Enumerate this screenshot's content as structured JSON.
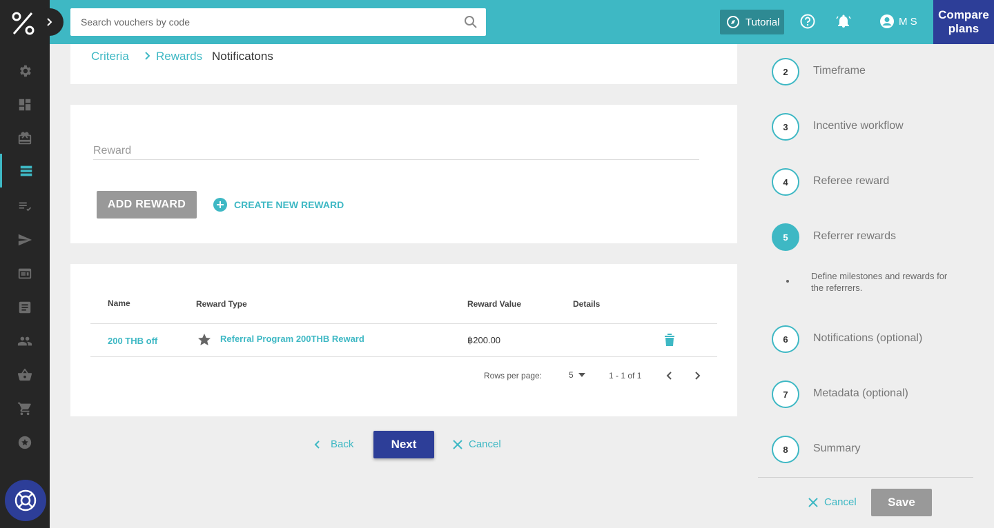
{
  "app": {
    "logo_text": "%",
    "accent_color": "#3eb8c4",
    "brand_color": "#2d3e98"
  },
  "sidebar": {
    "items": [
      {
        "icon": "gear-icon"
      },
      {
        "icon": "dashboard-icon"
      },
      {
        "icon": "gift-card-icon"
      },
      {
        "icon": "campaigns-list-icon",
        "active": true
      },
      {
        "icon": "validation-rules-icon"
      },
      {
        "icon": "send-icon"
      },
      {
        "icon": "distribution-icon"
      },
      {
        "icon": "log-icon"
      },
      {
        "icon": "customers-icon"
      },
      {
        "icon": "products-icon"
      },
      {
        "icon": "orders-cart-icon"
      },
      {
        "icon": "loyalty-star-icon"
      }
    ],
    "help_icon": "lifebuoy-icon"
  },
  "topbar": {
    "search_placeholder": "Search vouchers by code",
    "tutorial_label": "Tutorial",
    "user_initials": "M S",
    "compare_label_1": "Compare",
    "compare_label_2": "plans"
  },
  "breadcrumb": {
    "items": [
      "Criteria",
      "Rewards",
      "Notificatons"
    ]
  },
  "reward_form": {
    "field_label": "Reward",
    "add_button": "ADD REWARD",
    "create_link": "CREATE NEW REWARD"
  },
  "table": {
    "headers": [
      "Name",
      "Reward Type",
      "Reward Value",
      "Details"
    ],
    "rows": [
      {
        "name": "200 THB off",
        "type": "Referral Program 200THB Reward",
        "value": "฿200.00"
      }
    ],
    "rows_per_page_label": "Rows per page:",
    "rows_per_page_value": "5",
    "range": "1 - 1 of 1"
  },
  "actions": {
    "back": "Back",
    "next": "Next",
    "cancel": "Cancel"
  },
  "steps": [
    {
      "number": "2",
      "label": "Timeframe"
    },
    {
      "number": "3",
      "label": "Incentive workflow"
    },
    {
      "number": "4",
      "label": "Referee reward"
    },
    {
      "number": "5",
      "label": "Referrer rewards",
      "active": true,
      "description": "Define milestones and rewards for the referrers."
    },
    {
      "number": "6",
      "label": "Notifications (optional)"
    },
    {
      "number": "7",
      "label": "Metadata (optional)"
    },
    {
      "number": "8",
      "label": "Summary"
    }
  ],
  "side_actions": {
    "cancel": "Cancel",
    "save": "Save"
  }
}
